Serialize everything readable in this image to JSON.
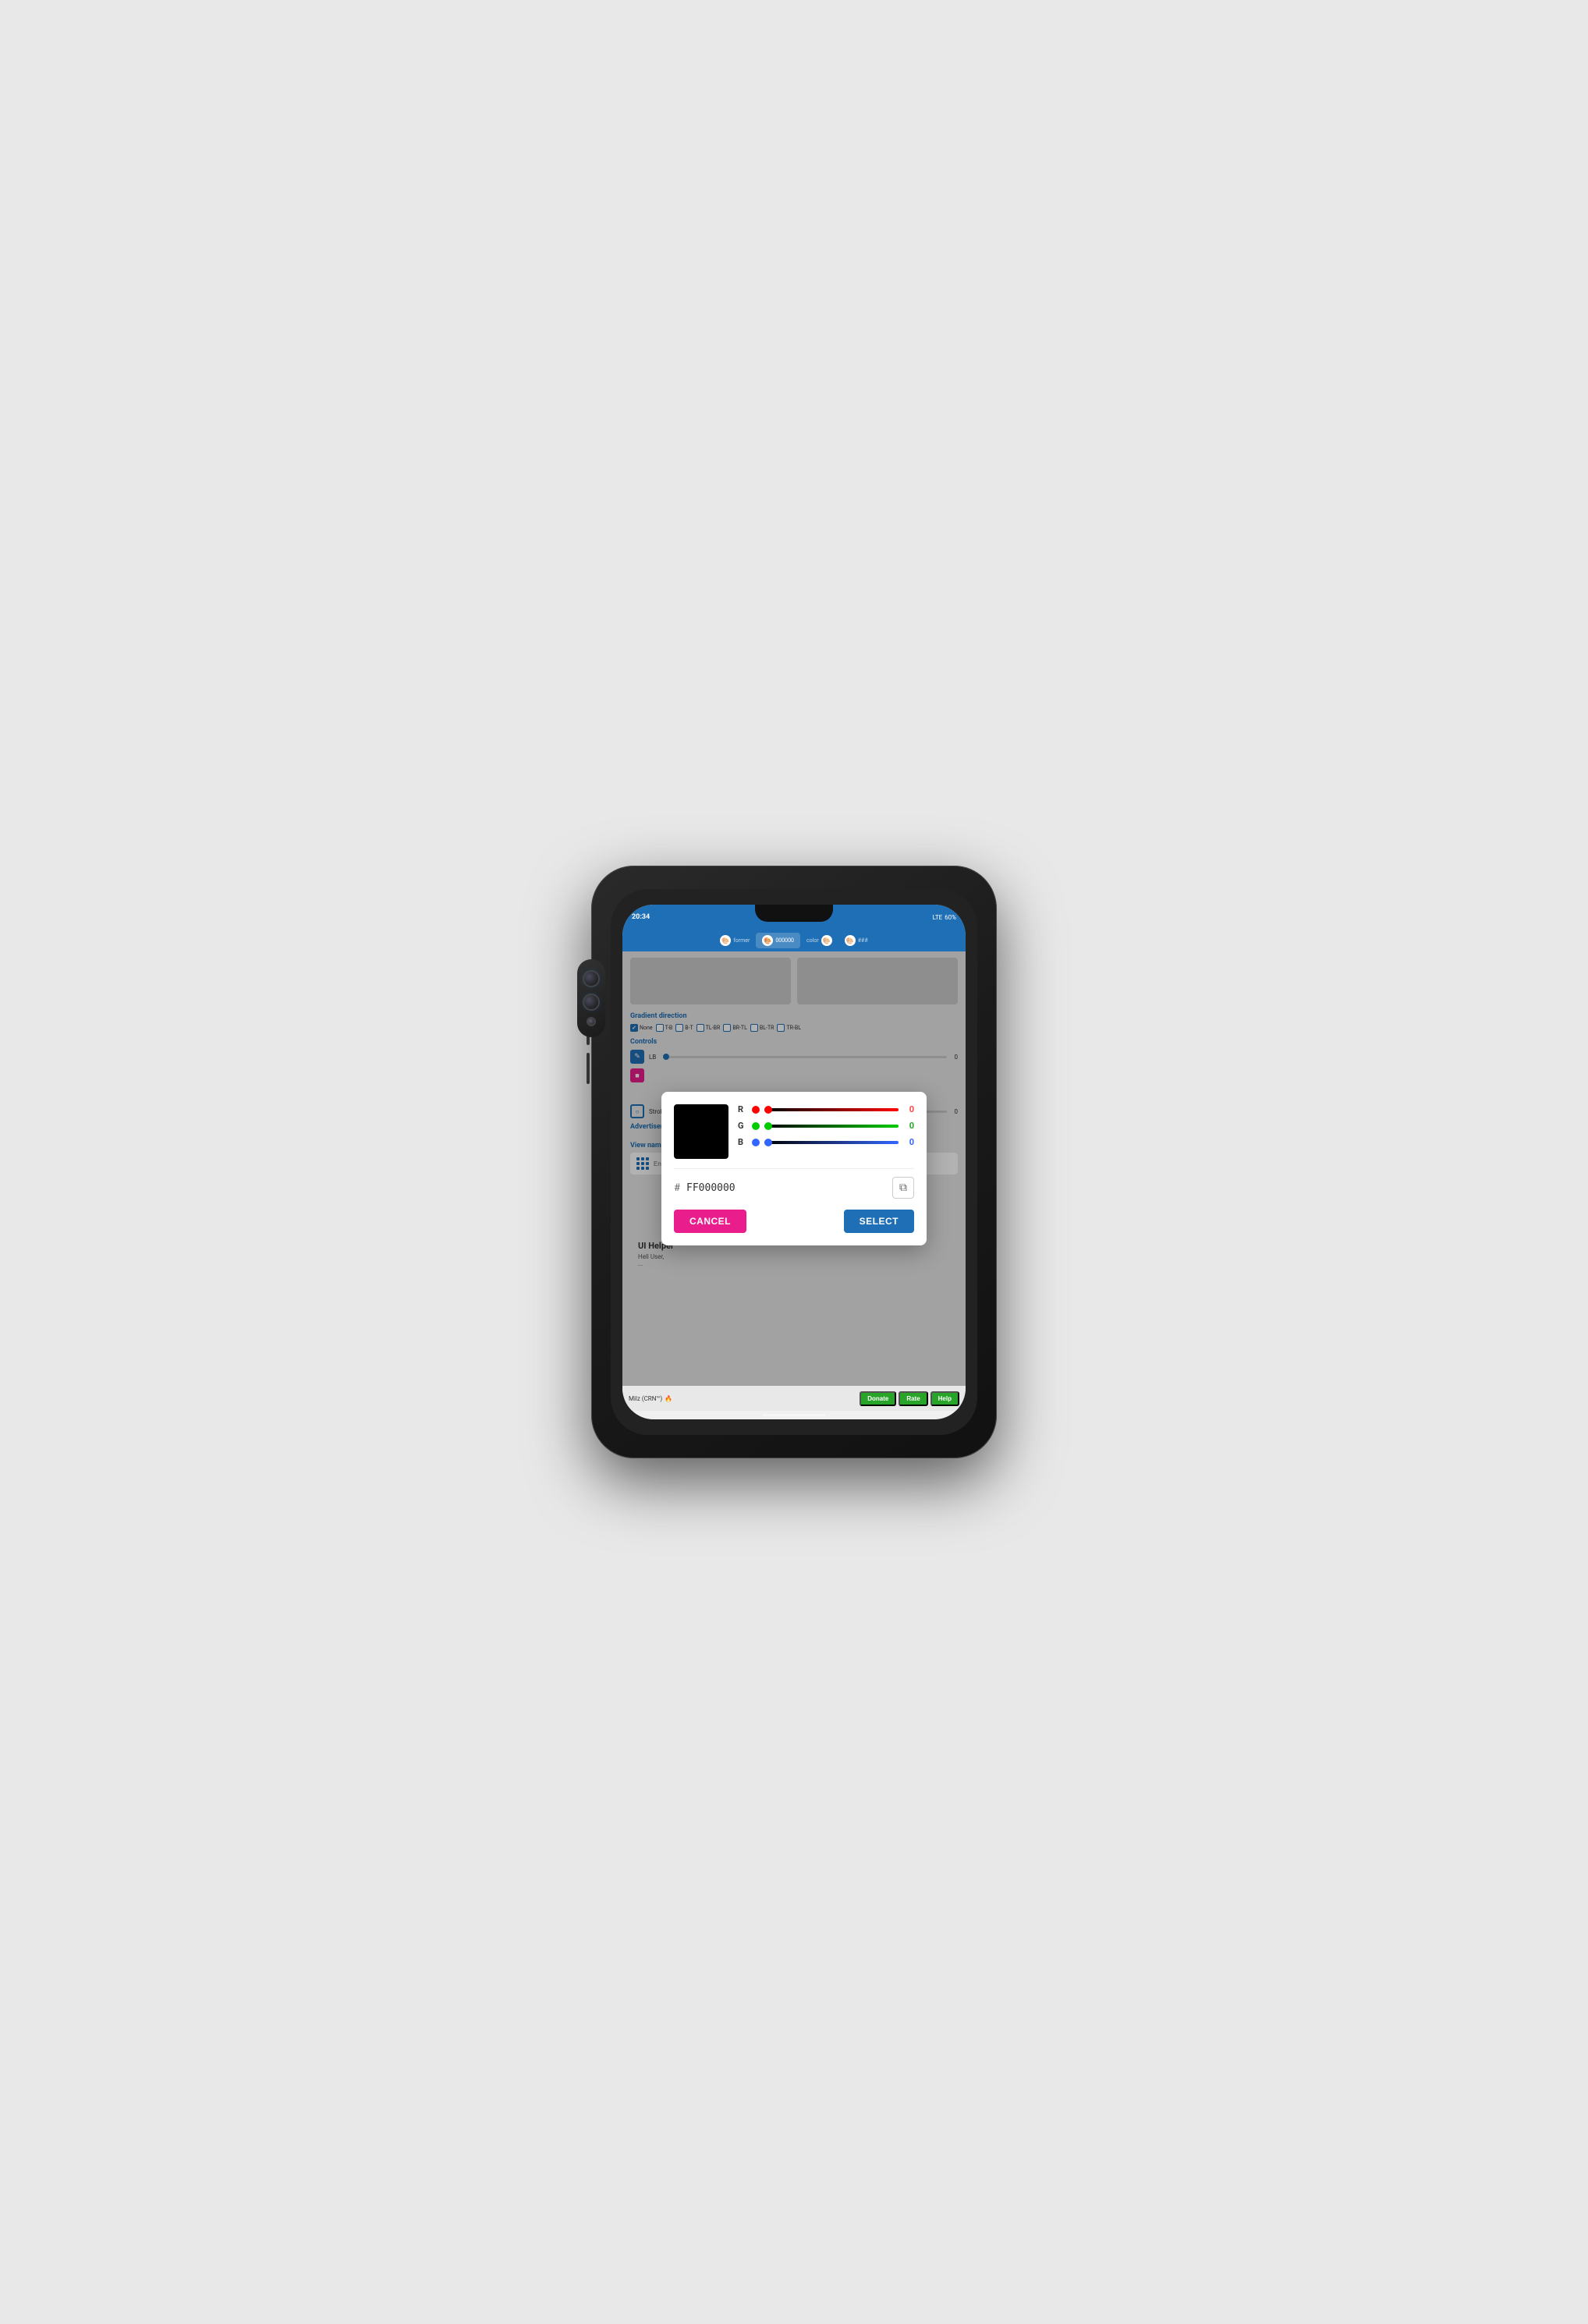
{
  "phone": {
    "status_bar": {
      "time": "20:34",
      "network": "LTE",
      "battery": "60%"
    },
    "tabs": [
      {
        "id": "former",
        "label": "former",
        "icon": "🎨",
        "active": false
      },
      {
        "id": "color",
        "label": "000000",
        "icon": "🎨",
        "active": true
      },
      {
        "id": "color2",
        "label": "color",
        "icon": "🎨",
        "active": false
      },
      {
        "id": "extra",
        "label": "###",
        "icon": "🎨",
        "active": false
      }
    ],
    "gradient": {
      "section_label": "Gradient direction",
      "options": [
        {
          "id": "none",
          "label": "None",
          "checked": true
        },
        {
          "id": "tb",
          "label": "T-B",
          "checked": false
        },
        {
          "id": "bt",
          "label": "B-T",
          "checked": false
        },
        {
          "id": "tlbr",
          "label": "TL-BR",
          "checked": false
        },
        {
          "id": "brtl",
          "label": "BR-TL",
          "checked": false
        },
        {
          "id": "bltr",
          "label": "BL-TR",
          "checked": false
        },
        {
          "id": "trbl",
          "label": "TR-BL",
          "checked": false
        }
      ]
    },
    "controls": {
      "section_label": "Controls",
      "lb_label": "LB",
      "lb_value": "0",
      "stroke_label": "Stroke",
      "stroke_value": "0"
    },
    "color_dialog": {
      "r_label": "R",
      "g_label": "G",
      "b_label": "B",
      "r_value": "0",
      "g_value": "0",
      "b_value": "0",
      "r_color": "#ff0000",
      "g_color": "#00cc00",
      "b_color": "#3366ff",
      "hex_label": "#",
      "hex_value": "FF000000",
      "cancel_label": "CANCEL",
      "select_label": "SELECT",
      "preview_color": "#000000"
    },
    "advertisement": {
      "section_label": "Advertisement"
    },
    "view_name": {
      "label": "View name",
      "placeholder": "Enter view name here e.g linear1"
    },
    "app_info": {
      "title": "UI Helper",
      "description": "Hell User,",
      "sub_text": "..."
    },
    "author": {
      "name": "Milz (CRN™)",
      "fire_emoji": "🔥"
    },
    "actions": {
      "donate": "Donate",
      "rate": "Rate",
      "help": "Help"
    }
  }
}
